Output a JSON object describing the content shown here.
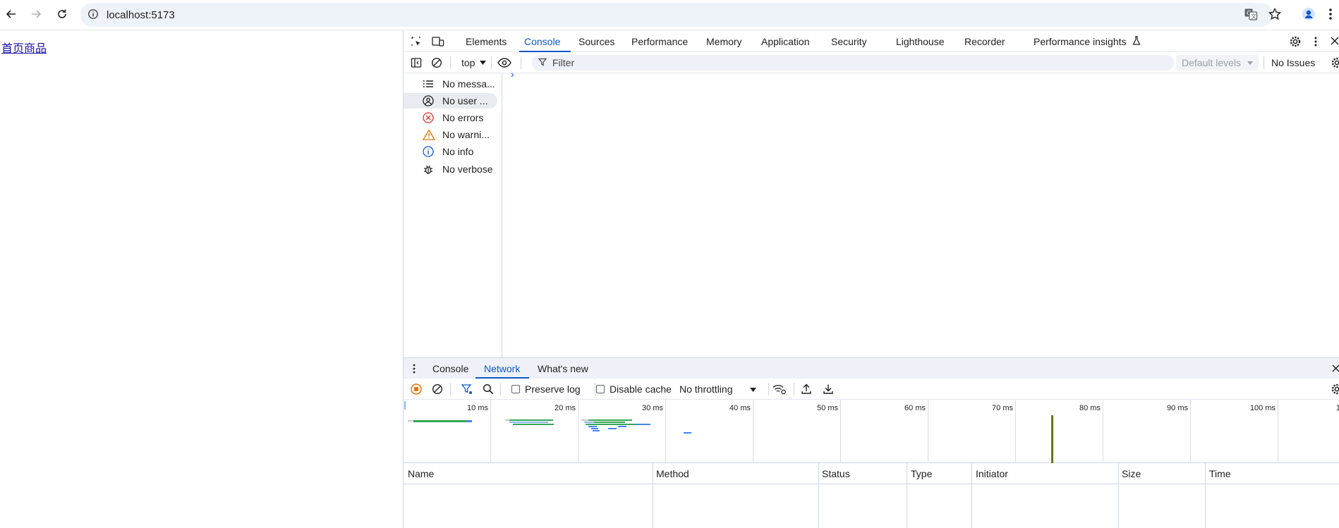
{
  "browser": {
    "url": "localhost:5173",
    "icons": [
      "back-icon",
      "forward-icon",
      "reload-icon",
      "site-info-icon",
      "translate-icon",
      "bookmark-star-icon",
      "profile-icon",
      "menu-icon"
    ]
  },
  "page": {
    "link_text": "首页商品"
  },
  "devtools": {
    "tabs": [
      "Elements",
      "Console",
      "Sources",
      "Performance",
      "Memory",
      "Application",
      "Security",
      "Lighthouse",
      "Recorder",
      "Performance insights"
    ],
    "active_tab": "Console",
    "console_toolbar": {
      "context": "top",
      "filter_placeholder": "Filter",
      "levels": "Default levels",
      "issues": "No Issues"
    },
    "sidebar": [
      {
        "label": "No messa...",
        "icon": "list-icon"
      },
      {
        "label": "No user ...",
        "icon": "user-icon"
      },
      {
        "label": "No errors",
        "icon": "error-icon"
      },
      {
        "label": "No warni...",
        "icon": "warning-icon"
      },
      {
        "label": "No info",
        "icon": "info-icon"
      },
      {
        "label": "No verbose",
        "icon": "bug-icon"
      }
    ],
    "prompt": "›",
    "drawer": {
      "tabs": [
        "Console",
        "Network",
        "What's new"
      ],
      "active_tab": "Network"
    },
    "network": {
      "preserve_log": "Preserve log",
      "disable_cache": "Disable cache",
      "throttling": "No throttling",
      "timeline_ticks": [
        "10 ms",
        "20 ms",
        "30 ms",
        "40 ms",
        "50 ms",
        "60 ms",
        "70 ms",
        "80 ms",
        "90 ms",
        "100 ms",
        "1"
      ],
      "columns": [
        "Name",
        "Method",
        "Status",
        "Type",
        "Initiator",
        "Size",
        "Time"
      ]
    },
    "colors": {
      "accent": "#0b57d0",
      "record": "#e8710a",
      "error": "#dc362e",
      "warning": "#e37400",
      "info": "#0b57d0"
    }
  }
}
